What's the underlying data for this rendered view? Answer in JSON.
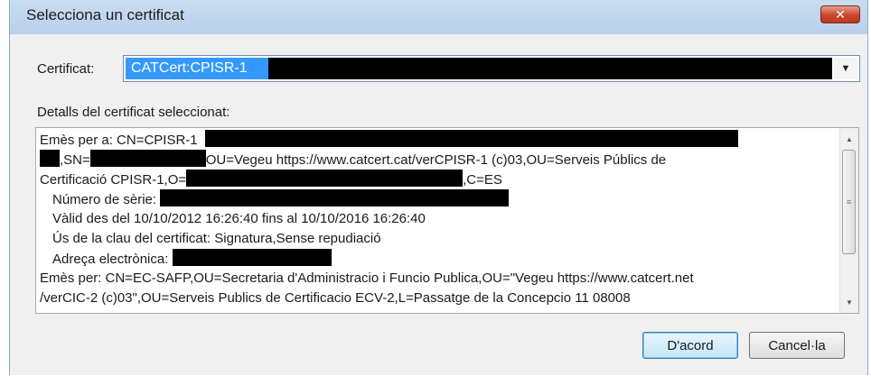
{
  "window": {
    "title": "Selecciona un certificat",
    "close_symbol": "✕"
  },
  "certificate": {
    "label": "Certificat:",
    "selected": "CATCert:CPISR-1"
  },
  "details": {
    "label": "Detalls del certificat seleccionat:",
    "issued_to_prefix": "Emès per a: CN=CPISR-1",
    "sn_label": ",SN=",
    "ou_text": "OU=Vegeu https://www.catcert.cat/verCPISR-1 (c)03,OU=Serveis Públics de",
    "cert_org": "Certificació CPISR-1,O=",
    "country": ",C=ES",
    "serial_label": "Número de sèrie:",
    "valid": "Vàlid des del 10/10/2012 16:26:40 fins al 10/10/2016 16:26:40",
    "key_usage": "Ús de la clau del certificat: Signatura,Sense repudiació",
    "email_label": "Adreça electrònica:",
    "issued_by_1": "Emès per: CN=EC-SAFP,OU=Secretaria d'Administracio i Funcio Publica,OU=\"Vegeu https://www.catcert.net",
    "issued_by_2": "/verCIC-2   (c)03\",OU=Serveis Publics de Certificacio ECV-2,L=Passatge de la Concepcio 11 08008"
  },
  "buttons": {
    "ok": "D'acord",
    "cancel": "Cancel·la"
  }
}
